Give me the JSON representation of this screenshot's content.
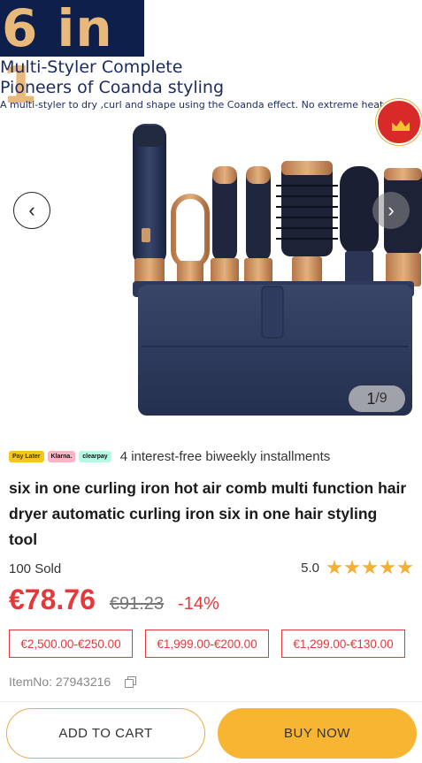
{
  "gallery": {
    "badge_text": "6 in 1",
    "headline_line1": "Multi-Styler Complete",
    "headline_line2": "Pioneers of Coanda styling",
    "subline": "A multi-styler to dry ,curl and shape using the Coanda effect. No extreme heat",
    "prev_icon": "‹",
    "next_icon": "›",
    "current_page": "1",
    "page_separator": "/",
    "total_pages": "9"
  },
  "payment": {
    "badges": [
      "Pay Later",
      "Klarna.",
      "clearpay"
    ],
    "installments_text": "4 interest-free biweekly installments"
  },
  "product": {
    "title": "six in one curling iron hot air comb multi function hair dryer automatic curling iron six in one hair styling tool",
    "sold": "100 Sold",
    "rating": "5.0",
    "stars": 5,
    "price": "€78.76",
    "old_price": "€91.23",
    "discount": "-14%",
    "coupons": [
      "€2,500.00-€250.00",
      "€1,999.00-€200.00",
      "€1,299.00-€130.00"
    ],
    "item_no": "ItemNo: 27943216"
  },
  "actions": {
    "add_to_cart": "ADD TO CART",
    "buy_now": "BUY NOW"
  },
  "colors": {
    "accent": "#f8b531",
    "price_red": "#e5383b",
    "star": "#f2b134"
  }
}
